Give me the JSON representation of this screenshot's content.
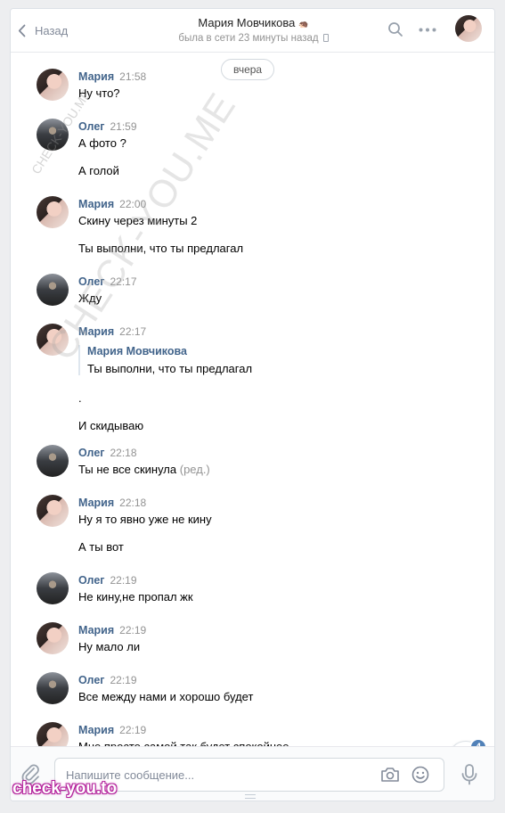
{
  "header": {
    "back_label": "Назад",
    "title": "Мария Мовчикова",
    "title_suffix": "🦔",
    "status": "была в сети 23 минуты назад"
  },
  "date_separator": "вчера",
  "messages": [
    {
      "author": "Мария",
      "time": "21:58",
      "lines": [
        "Ну что?"
      ]
    },
    {
      "author": "Олег",
      "time": "21:59",
      "lines": [
        "А фото ?",
        "А голой"
      ]
    },
    {
      "author": "Мария",
      "time": "22:00",
      "lines": [
        "Скину через минуты 2",
        "Ты выполни, что ты предлагал"
      ]
    },
    {
      "author": "Олег",
      "time": "22:17",
      "lines": [
        "Жду"
      ]
    },
    {
      "author": "Мария",
      "time": "22:17",
      "quote": {
        "author": "Мария Мовчикова",
        "text": "Ты выполни, что ты предлагал"
      },
      "lines": [
        ".",
        "И скидываю"
      ]
    },
    {
      "author": "Олег",
      "time": "22:18",
      "lines": [
        "Ты не все скинула"
      ],
      "edited": "(ред.)"
    },
    {
      "author": "Мария",
      "time": "22:18",
      "lines": [
        "Ну я то явно уже не кину",
        "А ты вот"
      ]
    },
    {
      "author": "Олег",
      "time": "22:19",
      "lines": [
        "Не кину,не пропал жк"
      ]
    },
    {
      "author": "Мария",
      "time": "22:19",
      "lines": [
        "Ну мало ли"
      ]
    },
    {
      "author": "Олег",
      "time": "22:19",
      "lines": [
        "Все между нами и хорошо будет"
      ]
    },
    {
      "author": "Мария",
      "time": "22:19",
      "lines": [
        "Мне просто самой так будет спокойнее"
      ]
    }
  ],
  "unread_badge": "4",
  "composer": {
    "placeholder": "Напишите сообщение..."
  },
  "watermarks": {
    "diagonal": "CHECK-YOU.ME",
    "small": "CHECK-YOU.ME",
    "bottom": "check-you.to"
  },
  "colors": {
    "accent": "#5181b8",
    "author": "#42648b",
    "muted": "#939393",
    "background": "#edeef0"
  }
}
